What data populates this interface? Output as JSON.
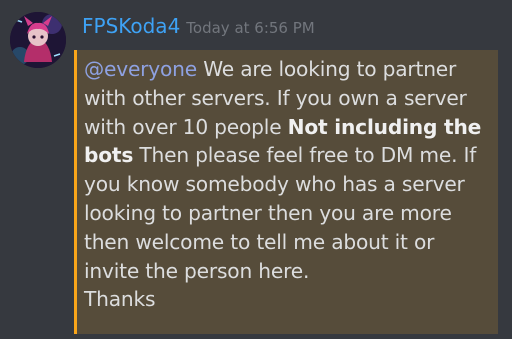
{
  "author": {
    "username": "FPSKoda4",
    "timestamp": "Today at 6:56 PM",
    "avatar_icon": "anime-avatar"
  },
  "message": {
    "mention": "@everyone",
    "line1_rest": " We are looking to partner",
    "line2": "with other servers. If you own a server",
    "line3_plain": "with over 10 people ",
    "line3_bold": "Not including the",
    "line4_bold": "bots",
    "line4_rest": " Then please feel free to DM me. If",
    "line5": "you know somebody who has a server",
    "line6": "looking to partner then you are more",
    "line7": "then welcome to tell me about it or",
    "line8": "invite the person here.",
    "line9": "Thanks"
  },
  "colors": {
    "background": "#36393f",
    "username": "#3ea2f5",
    "highlight_bg": "#564c3a",
    "highlight_border": "#faa61a",
    "mention": "#8ea1e1"
  }
}
